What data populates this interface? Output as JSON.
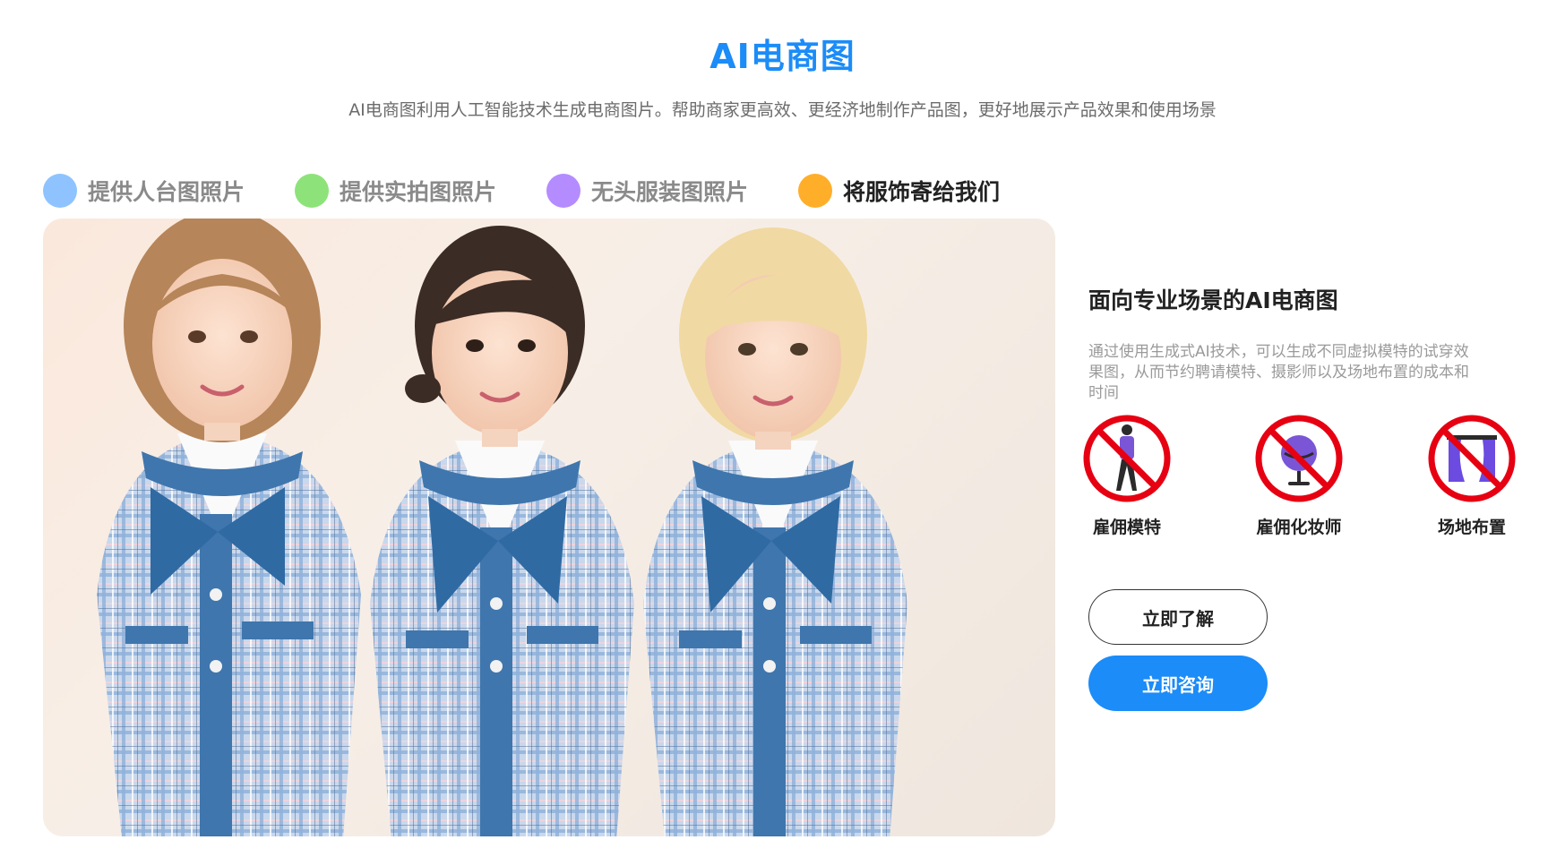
{
  "header": {
    "title": "AI电商图",
    "subtitle": "AI电商图利用人工智能技术生成电商图片。帮助商家更高效、更经济地制作产品图，更好地展示产品效果和使用场景"
  },
  "tabs": [
    {
      "label": "提供人台图照片",
      "color": "#8fc3ff",
      "active": false
    },
    {
      "label": "提供实拍图照片",
      "color": "#8ee27a",
      "active": false
    },
    {
      "label": "无头服装图照片",
      "color": "#b48cff",
      "active": false
    },
    {
      "label": "将服饰寄给我们",
      "color": "#ffae2a",
      "active": true
    }
  ],
  "side": {
    "title": "面向专业场景的AI电商图",
    "description": "通过使用生成式AI技术，可以生成不同虚拟模特的试穿效果图，从而节约聘请模特、摄影师以及场地布置的成本和时间",
    "features": [
      {
        "label": "雇佣模特",
        "icon": "no-model-icon"
      },
      {
        "label": "雇佣化妆师",
        "icon": "no-makeup-artist-icon"
      },
      {
        "label": "场地布置",
        "icon": "no-venue-setup-icon"
      }
    ],
    "buttons": {
      "learn_more": "立即了解",
      "consult": "立即咨询"
    }
  },
  "colors": {
    "accent": "#1b8cf8",
    "prohibit_red": "#e60012"
  }
}
